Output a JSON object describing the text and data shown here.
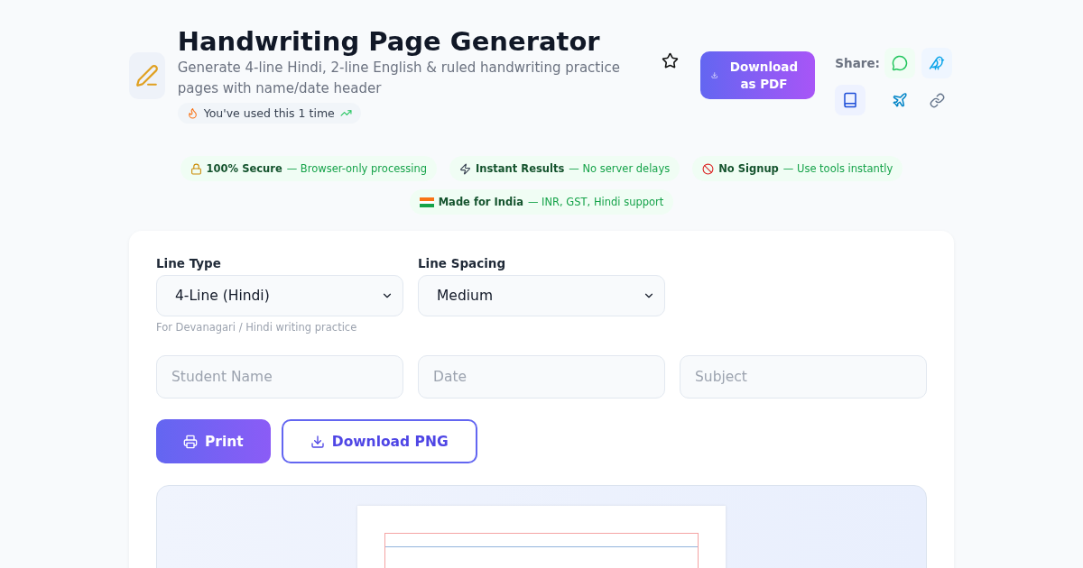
{
  "header": {
    "title": "Handwriting Page Generator",
    "subtitle": "Generate 4-line Hindi, 2-line English & ruled handwriting practice pages with name/date header",
    "usage": "You've used this 1 time",
    "favorite": false,
    "download_button": "Download as PDF",
    "share_label": "Share:"
  },
  "badges": [
    {
      "kind": "lock",
      "title": "100% Secure",
      "detail": "— Browser-only processing"
    },
    {
      "kind": "bolt",
      "title": "Instant Results",
      "detail": "— No server delays"
    },
    {
      "kind": "ban",
      "title": "No Signup",
      "detail": "— Use tools instantly"
    },
    {
      "kind": "flag",
      "title": "Made for India",
      "detail": "— INR, GST, Hindi support"
    }
  ],
  "form": {
    "line_type": {
      "label": "Line Type",
      "value": "4-Line (Hindi)",
      "hint": "For Devanagari / Hindi writing practice"
    },
    "line_spacing": {
      "label": "Line Spacing",
      "value": "Medium"
    },
    "fields": [
      {
        "placeholder": "Student Name"
      },
      {
        "placeholder": "Date"
      },
      {
        "placeholder": "Subject"
      }
    ],
    "print_button": "Print",
    "png_button": "Download PNG"
  }
}
